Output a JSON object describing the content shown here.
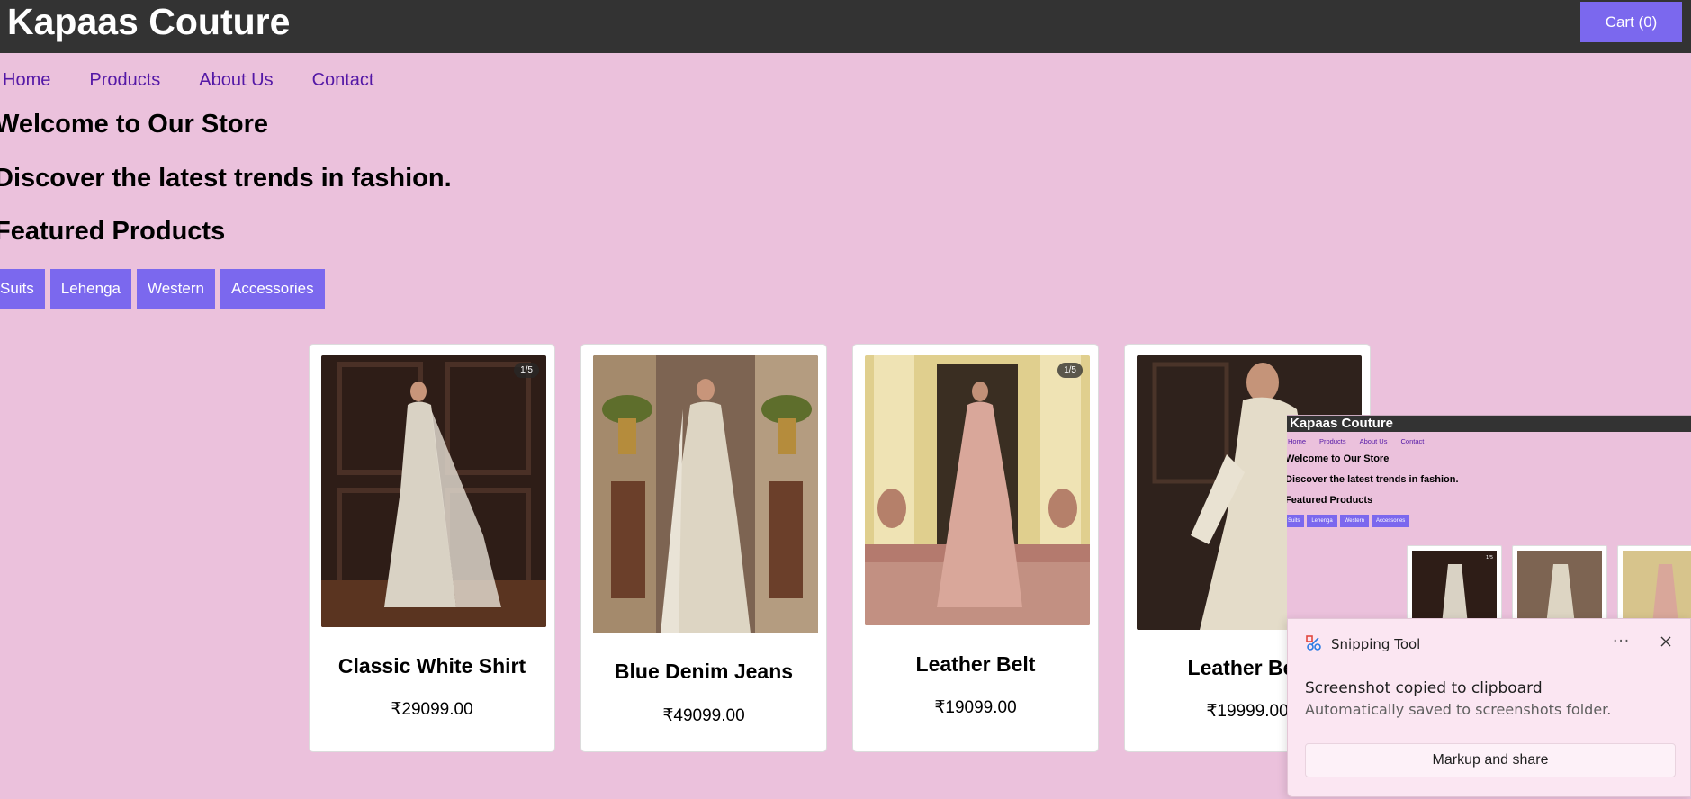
{
  "header": {
    "brand": "Kapaas Couture",
    "cart_label": "Cart (0)"
  },
  "nav": {
    "items": [
      {
        "label": "Home"
      },
      {
        "label": "Products"
      },
      {
        "label": "About Us"
      },
      {
        "label": "Contact"
      }
    ]
  },
  "hero": {
    "welcome": "Welcome to Our Store",
    "tagline": "Discover the latest trends in fashion.",
    "featured": "Featured Products"
  },
  "categories": [
    {
      "label": "Suits"
    },
    {
      "label": "Lehenga"
    },
    {
      "label": "Western"
    },
    {
      "label": "Accessories"
    }
  ],
  "products": [
    {
      "name": "Classic White Shirt",
      "price": "₹29099.00",
      "badge": "1/5"
    },
    {
      "name": "Blue Denim Jeans",
      "price": "₹49099.00",
      "badge": ""
    },
    {
      "name": "Leather Belt",
      "price": "₹19099.00",
      "badge": "1/5"
    },
    {
      "name": "Leather Belt",
      "price": "₹19999.00",
      "badge": ""
    }
  ],
  "thumbnail": {
    "brand": "Kapaas Couture",
    "nav": [
      "Home",
      "Products",
      "About Us",
      "Contact"
    ],
    "welcome": "Welcome to Our Store",
    "tagline": "Discover the latest trends in fashion.",
    "featured": "Featured Products",
    "categories": [
      "Suits",
      "Lehenga",
      "Western",
      "Accessories"
    ],
    "badge": "1/5"
  },
  "notification": {
    "app_name": "Snipping Tool",
    "more_label": "···",
    "title": "Screenshot copied to clipboard",
    "subtitle": "Automatically saved to screenshots folder.",
    "action_label": "Markup and share"
  },
  "colors": {
    "page_bg": "#ebc1dc",
    "header_bg": "#333333",
    "accent": "#7b68ee",
    "nav_link": "#5418a6"
  }
}
